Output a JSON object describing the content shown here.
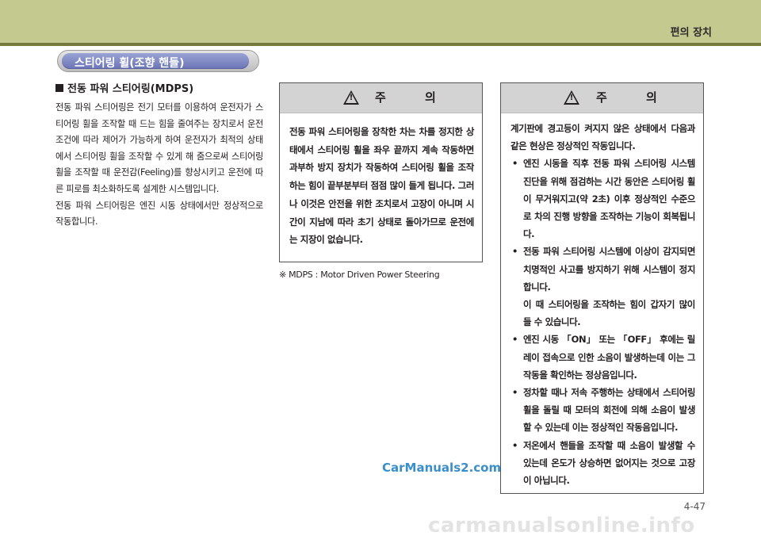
{
  "header": {
    "title": "편의 장치"
  },
  "section": {
    "title": "스티어링 휠(조향 핸들)"
  },
  "mdps": {
    "heading": "전동 파워 스티어링(MDPS)",
    "paragraph1": "전동 파워 스티어링은 전기 모터를 이용하여 운전자가 스티어링 휠을 조작할 때 드는 힘을 줄여주는 장치로서 운전 조건에 따라 제어가 가능하게 하여 운전자가 최적의 상태에서 스티어링 휠을 조작할 수 있게 해 줌으로써 스티어링 휠을 조작할 때 운전감(Feeling)를 향상시키고 운전에 따른 피로를 최소화하도록 설계한 시스템입니다.",
    "paragraph2": "전동 파워 스티어링은 엔진 시동 상태에서만 정상적으로 작동합니다."
  },
  "caution_left": {
    "title": "주 의",
    "warning_mark": "!",
    "text": "전동 파워 스티어링을 장착한 차는 차를 정지한 상태에서 스티어링 휠을 좌우 끝까지 계속 작동하면 과부하 방지 장치가 작동하여 스티어링 휠을 조작하는 힘이 끝부분부터 점점 많이 들게 됩니다. 그러나 이것은 안전을 위한 조치로서 고장이 아니며 시간이 지남에 따라 초기 상태로 돌아가므로 운전에는 지장이 없습니다."
  },
  "note": "※ MDPS : Motor Driven Power Steering",
  "caution_right": {
    "title": "주 의",
    "warning_mark": "!",
    "intro": "계기판에 경고등이 켜지지 않은 상태에서 다음과 같은 현상은 정상적인 작동입니다.",
    "bullet_char": "•",
    "bullets": [
      "엔진 시동을 직후 전동 파워 스티어링 시스템 진단을 위해 점검하는 시간 동안은 스티어링 휠이 무거워지고(약 2초) 이후 정상적인 수준으로 차의 진행 방향을 조작하는 기능이 회복됩니다.",
      "전동 파워 스티어링 시스템에 이상이 감지되면 치명적인 사고를 방지하기 위해 시스템이 정지합니다.",
      "엔진 시동 「ON」 또는 「OFF」 후에는 릴레이 접속으로 인한 소음이 발생하는데 이는 그 작동을 확인하는 정상음입니다.",
      "정차할 때나 저속 주행하는 상태에서 스티어링 휠을 돌릴 때 모터의 회전에 의해 소음이 발생할 수 있는데 이는 정상적인 작동음입니다.",
      "저온에서 핸들을 조작할 때 소음이 발생할 수 있는데 온도가 상승하면 없어지는 것으로 고장이 아닙니다."
    ],
    "bullet2_extra": "이 때 스티어링을 조작하는 힘이 갑자기 많이 들 수 있습니다."
  },
  "watermark": "CarManuals2.com",
  "page_number": "4-47",
  "footer_logo": "carmanualsonline.info",
  "colors": {
    "topbar": "#c4c98f",
    "topbar_line": "#74793c",
    "pill": "#6b75b6",
    "caution_header": "#d3d3d3",
    "watermark": "#3a8fc9"
  },
  "icons": {
    "warning": "warning-triangle-icon",
    "heading_marker": "square-bullet-icon"
  }
}
